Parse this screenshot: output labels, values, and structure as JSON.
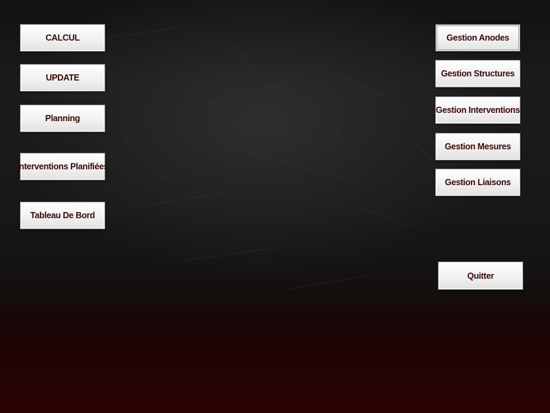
{
  "left_menu": {
    "calcul": "CALCUL",
    "update": "UPDATE",
    "planning": "Planning",
    "interventions_planifiees": "Interventions Planifiées",
    "tableau_de_bord": "Tableau De Bord"
  },
  "right_menu": {
    "gestion_anodes": "Gestion Anodes",
    "gestion_structures": "Gestion Structures",
    "gestion_interventions": "Gestion Interventions",
    "gestion_mesures": "Gestion Mesures",
    "gestion_liaisons": "Gestion Liaisons"
  },
  "quit": {
    "label": "Quitter"
  },
  "colors": {
    "label_text": "#3a0a0a",
    "background_top": "#121212",
    "background_bottom": "#2a0303"
  }
}
